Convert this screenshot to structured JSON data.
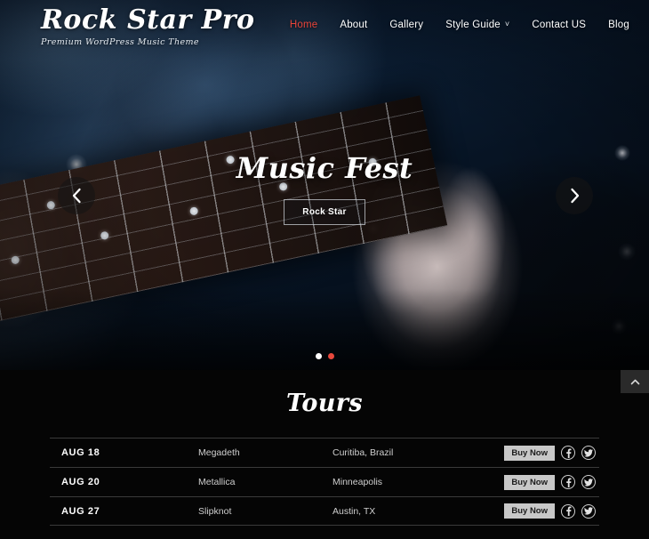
{
  "header": {
    "brand_title": "Rock Star Pro",
    "brand_tagline": "Premium WordPress Music Theme",
    "accent_color": "#e8443a",
    "nav": [
      {
        "label": "Home",
        "active": true,
        "has_dropdown": false
      },
      {
        "label": "About",
        "active": false,
        "has_dropdown": false
      },
      {
        "label": "Gallery",
        "active": false,
        "has_dropdown": false
      },
      {
        "label": "Style Guide",
        "active": false,
        "has_dropdown": true,
        "caret": "chevron-down-icon"
      },
      {
        "label": "Contact US",
        "active": false,
        "has_dropdown": false
      },
      {
        "label": "Blog",
        "active": false,
        "has_dropdown": false
      }
    ]
  },
  "hero": {
    "title": "Music Fest",
    "button_label": "Rock Star",
    "prev_icon": "chevron-left-icon",
    "next_icon": "chevron-right-icon",
    "dots": [
      {
        "active": false
      },
      {
        "active": true
      }
    ],
    "dot_active_color": "#e8483c"
  },
  "tours": {
    "title": "Tours",
    "rows": [
      {
        "date": "AUG 18",
        "band": "Megadeth",
        "location": "Curitiba, Brazil",
        "buy_label": "Buy Now",
        "facebook_icon": "facebook-icon",
        "twitter_icon": "twitter-icon"
      },
      {
        "date": "AUG 20",
        "band": "Metallica",
        "location": "Minneapolis",
        "buy_label": "Buy Now",
        "facebook_icon": "facebook-icon",
        "twitter_icon": "twitter-icon"
      },
      {
        "date": "AUG 27",
        "band": "Slipknot",
        "location": "Austin, TX",
        "buy_label": "Buy Now",
        "facebook_icon": "facebook-icon",
        "twitter_icon": "twitter-icon"
      }
    ]
  },
  "back_to_top": {
    "icon": "chevron-up-icon"
  }
}
